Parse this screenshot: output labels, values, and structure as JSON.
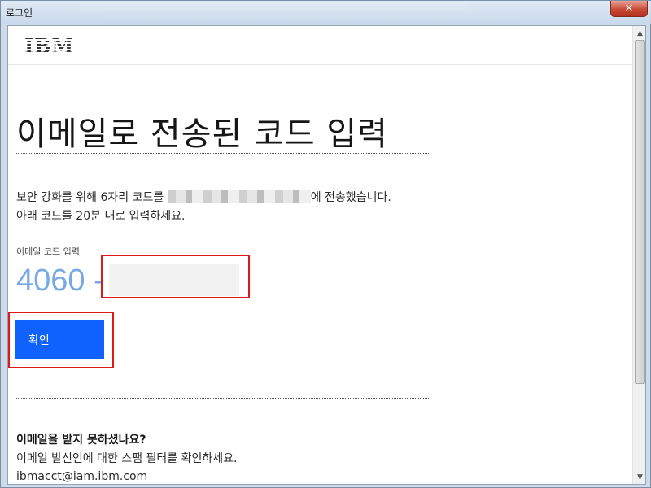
{
  "window": {
    "title": "로그인",
    "close_label": "✕"
  },
  "header": {
    "logo": "IBM"
  },
  "main": {
    "title": "이메일로 전송된 코드 입력",
    "desc_line1_prefix": "보안 강화를 위해 6자리 코드를 ",
    "desc_line1_suffix": "에 전송했습니다.",
    "desc_line2": "아래 코드를 20분 내로 입력하세요.",
    "code_label": "이메일 코드 입력",
    "code_prefix": "4060 -",
    "code_value": "",
    "confirm_label": "확인"
  },
  "help": {
    "title": "이메일을 받지 못하셨나요?",
    "text": "이메일 발신인에 대한 스팸 필터를 확인하세요.",
    "email": "ibmacct@iam.ibm.com"
  },
  "icons": {
    "scroll_up": "▲",
    "scroll_down": "▼"
  },
  "colors": {
    "primary_button": "#0f62fe",
    "code_prefix": "#78a9e6",
    "highlight": "#e01818"
  }
}
